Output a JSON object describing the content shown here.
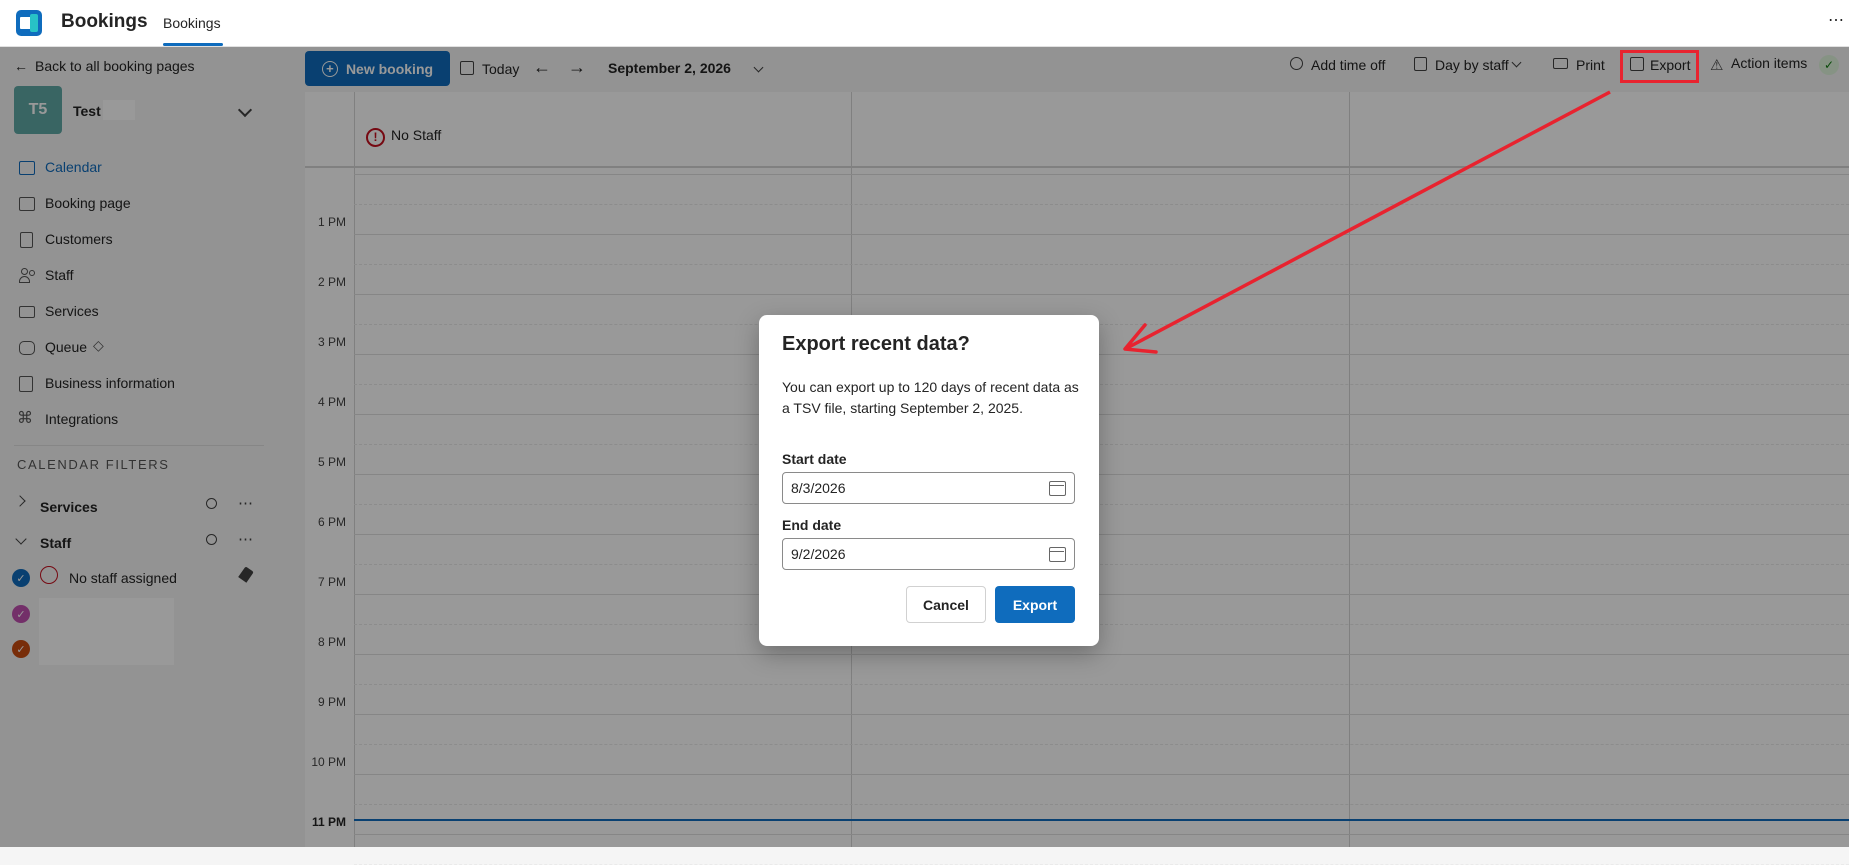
{
  "app": {
    "title": "Bookings",
    "tab": "Bookings",
    "more": "⋯"
  },
  "sidebar": {
    "back": "Back to all booking pages",
    "business": {
      "initials": "T5",
      "name": "Test"
    },
    "nav": [
      {
        "label": "Calendar",
        "icon": "calendar-icon"
      },
      {
        "label": "Booking page",
        "icon": "monitor-icon"
      },
      {
        "label": "Customers",
        "icon": "contact-card-icon"
      },
      {
        "label": "Staff",
        "icon": "people-icon"
      },
      {
        "label": "Services",
        "icon": "briefcase-icon"
      },
      {
        "label": "Queue",
        "icon": "queue-icon"
      },
      {
        "label": "Business information",
        "icon": "building-icon"
      },
      {
        "label": "Integrations",
        "icon": "integrations-icon"
      }
    ],
    "filters_heading": "CALENDAR FILTERS",
    "filters": {
      "services": "Services",
      "staff": "Staff"
    },
    "staff_items": [
      {
        "label": "No staff assigned"
      }
    ]
  },
  "toolbar": {
    "new_booking": "New booking",
    "today": "Today",
    "date": "September 2, 2026",
    "add_time_off": "Add time off",
    "view": "Day by staff",
    "print": "Print",
    "export": "Export",
    "action_items": "Action items"
  },
  "calendar": {
    "columns": [
      {
        "label": "No Staff"
      }
    ],
    "hours": [
      "1 PM",
      "2 PM",
      "3 PM",
      "4 PM",
      "5 PM",
      "6 PM",
      "7 PM",
      "8 PM",
      "9 PM",
      "10 PM",
      "11 PM"
    ]
  },
  "dialog": {
    "title": "Export recent data?",
    "body": "You can export up to 120 days of recent data as a TSV file, starting September 2, 2025.",
    "start_label": "Start date",
    "start_value": "8/3/2026",
    "end_label": "End date",
    "end_value": "9/2/2026",
    "cancel": "Cancel",
    "export": "Export"
  },
  "colors": {
    "accent": "#0f6cbd",
    "annotation": "#e8232f"
  }
}
